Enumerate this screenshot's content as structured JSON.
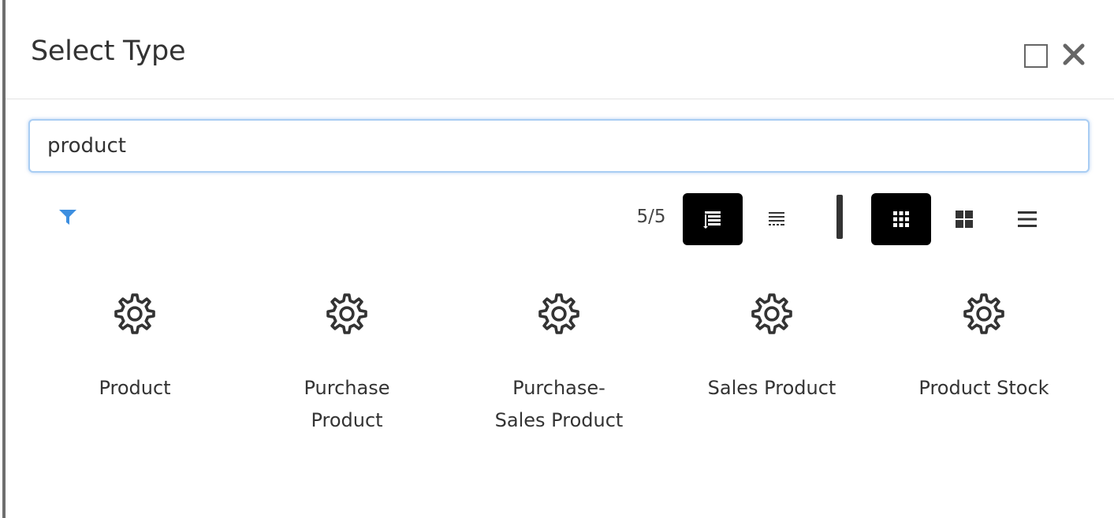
{
  "dialog": {
    "title": "Select Type"
  },
  "search": {
    "value": "product",
    "placeholder": ""
  },
  "toolbar": {
    "count": "5/5",
    "colors": {
      "filter_icon": "#3d8fe0",
      "active_button": "#000000"
    }
  },
  "items": [
    {
      "label": "Product",
      "icon": "gear-icon"
    },
    {
      "label": "Purchase Product",
      "icon": "gear-icon"
    },
    {
      "label": "Purchase-Sales Product",
      "icon": "gear-icon"
    },
    {
      "label": "Sales Product",
      "icon": "gear-icon"
    },
    {
      "label": "Product Stock",
      "icon": "gear-icon"
    }
  ]
}
